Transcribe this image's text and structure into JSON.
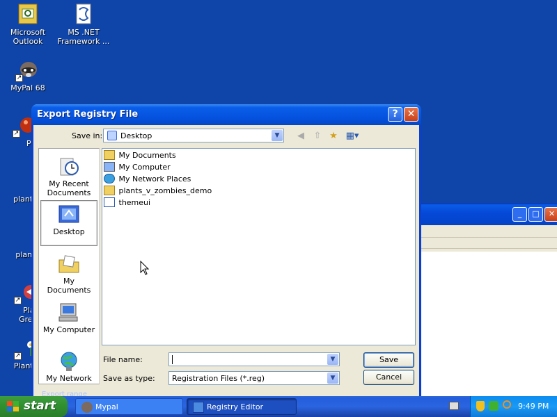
{
  "desktop": {
    "icons": [
      {
        "label": "Microsoft Outlook"
      },
      {
        "label": "MS .NET Framework ..."
      },
      {
        "label": "MyPal 68"
      },
      {
        "label": "Peg"
      },
      {
        "label": "plants_v"
      },
      {
        "label": "plants_"
      },
      {
        "label": "Play I Great C"
      },
      {
        "label": "Plant Zom"
      }
    ]
  },
  "dialog": {
    "title": "Export Registry File",
    "help_symbol": "?",
    "close_symbol": "✕",
    "save_in_label": "Save in:",
    "save_in_value": "Desktop",
    "places": [
      {
        "label": "My Recent Documents"
      },
      {
        "label": "Desktop"
      },
      {
        "label": "My Documents"
      },
      {
        "label": "My Computer"
      },
      {
        "label": "My Network"
      }
    ],
    "files": [
      {
        "name": "My Documents"
      },
      {
        "name": "My Computer"
      },
      {
        "name": "My Network Places"
      },
      {
        "name": "plants_v_zombies_demo"
      },
      {
        "name": "themeui"
      }
    ],
    "file_name_label": "File name:",
    "file_name_value": "",
    "save_as_type_label": "Save as type:",
    "save_as_type_value": "Registration Files (*.reg)",
    "save_button": "Save",
    "cancel_button": "Cancel",
    "export_range_partial": "Export range"
  },
  "taskbar": {
    "start_label": "start",
    "tasks": [
      {
        "label": "Mypal"
      },
      {
        "label": "Registry Editor"
      }
    ],
    "clock": "9:49 PM"
  },
  "colors": {
    "desktop_bg": "#0f44a8",
    "titlebar_blue": "#0553e0",
    "start_green": "#2f8f2f",
    "close_red": "#c8401a"
  }
}
